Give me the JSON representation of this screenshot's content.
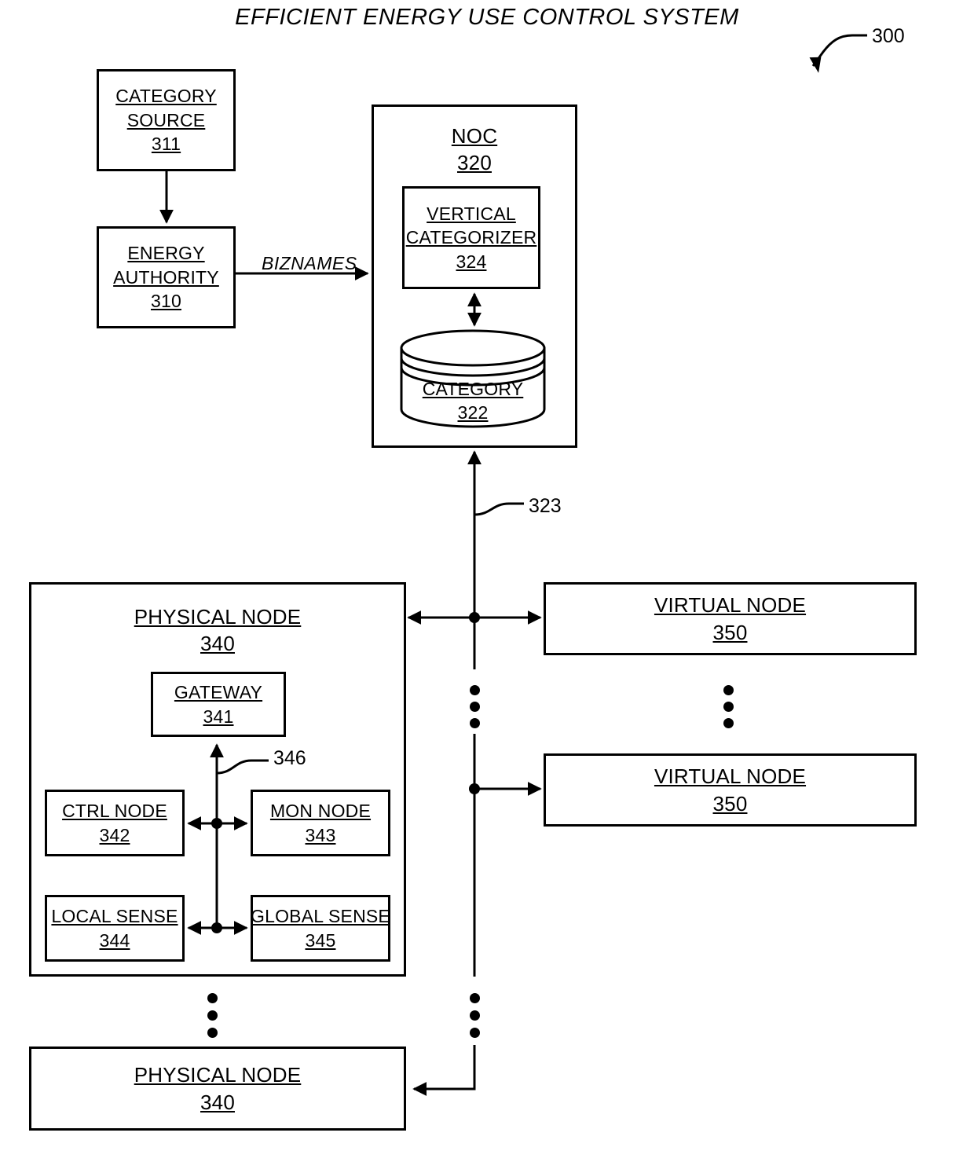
{
  "figure": {
    "title": "EFFICIENT ENERGY USE CONTROL SYSTEM",
    "ref_numeral": "300"
  },
  "blocks": {
    "category_source": {
      "label": "CATEGORY SOURCE",
      "line1": "CATEGORY",
      "line2": "SOURCE",
      "num": "311"
    },
    "energy_authority": {
      "label": "ENERGY AUTHORITY",
      "line1": "ENERGY",
      "line2": "AUTHORITY",
      "num": "310"
    },
    "noc": {
      "label": "NOC",
      "num": "320"
    },
    "vertical_categorizer": {
      "line1": "VERTICAL",
      "line2": "CATEGORIZER",
      "num": "324"
    },
    "category_db": {
      "label": "CATEGORY",
      "num": "322"
    },
    "physical_node_1": {
      "label": "PHYSICAL NODE",
      "num": "340"
    },
    "physical_node_2": {
      "label": "PHYSICAL NODE",
      "num": "340"
    },
    "gateway": {
      "label": "GATEWAY",
      "num": "341"
    },
    "ctrl_node": {
      "label": "CTRL NODE",
      "num": "342"
    },
    "mon_node": {
      "label": "MON NODE",
      "num": "343"
    },
    "local_sense": {
      "label": "LOCAL SENSE",
      "num": "344"
    },
    "global_sense": {
      "label": "GLOBAL SENSE",
      "num": "345"
    },
    "virtual_node_1": {
      "label": "VIRTUAL NODE",
      "num": "350"
    },
    "virtual_node_2": {
      "label": "VIRTUAL NODE",
      "num": "350"
    }
  },
  "connectors": {
    "biznames_label": "BIZNAMES",
    "network_bus_ref": "323",
    "internal_bus_ref": "346"
  },
  "colors": {
    "line": "#000000",
    "background": "#ffffff"
  }
}
